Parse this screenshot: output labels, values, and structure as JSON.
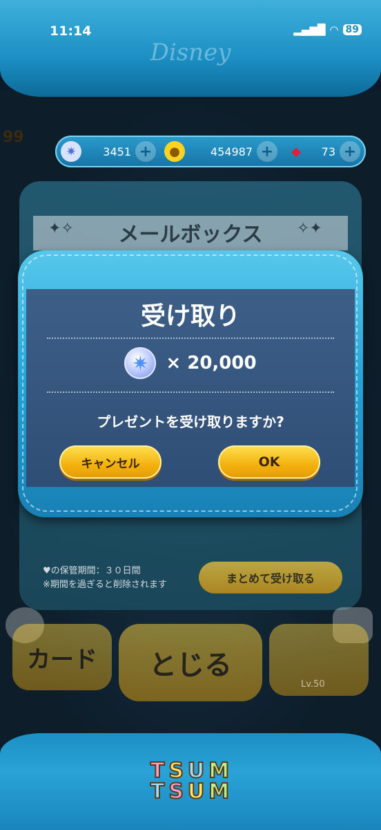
{
  "status_bar": {
    "time": "11:14",
    "battery": "89"
  },
  "brand": "Disney",
  "currency": {
    "gems": "3451",
    "coins": "454987",
    "rubies": "73",
    "plus_symbol": "+"
  },
  "level": "99",
  "mailbox": {
    "title": "メールボックス",
    "retention_line1": "♥の保管期間：３０日間",
    "retention_line2": "※期間を過ぎると削除されます",
    "bulk_receive_label": "まとめて受け取る"
  },
  "dialog": {
    "title": "受け取り",
    "reward_text": "× 20,000",
    "question": "プレゼントを受け取りますか?",
    "cancel_label": "キャンセル",
    "ok_label": "OK"
  },
  "bottom_nav": {
    "card_label": "カード",
    "close_label": "とじる",
    "character_level": "Lv.50"
  },
  "logo": {
    "line1": [
      "T",
      "S",
      "U",
      "M"
    ],
    "line2": [
      "T",
      "S",
      "U",
      "M"
    ]
  },
  "colors": {
    "denim": "#24a2d6",
    "dialog_inner": "#3d5f87",
    "button_yellow": "#f3b10e",
    "button_text": "#3a2406"
  }
}
